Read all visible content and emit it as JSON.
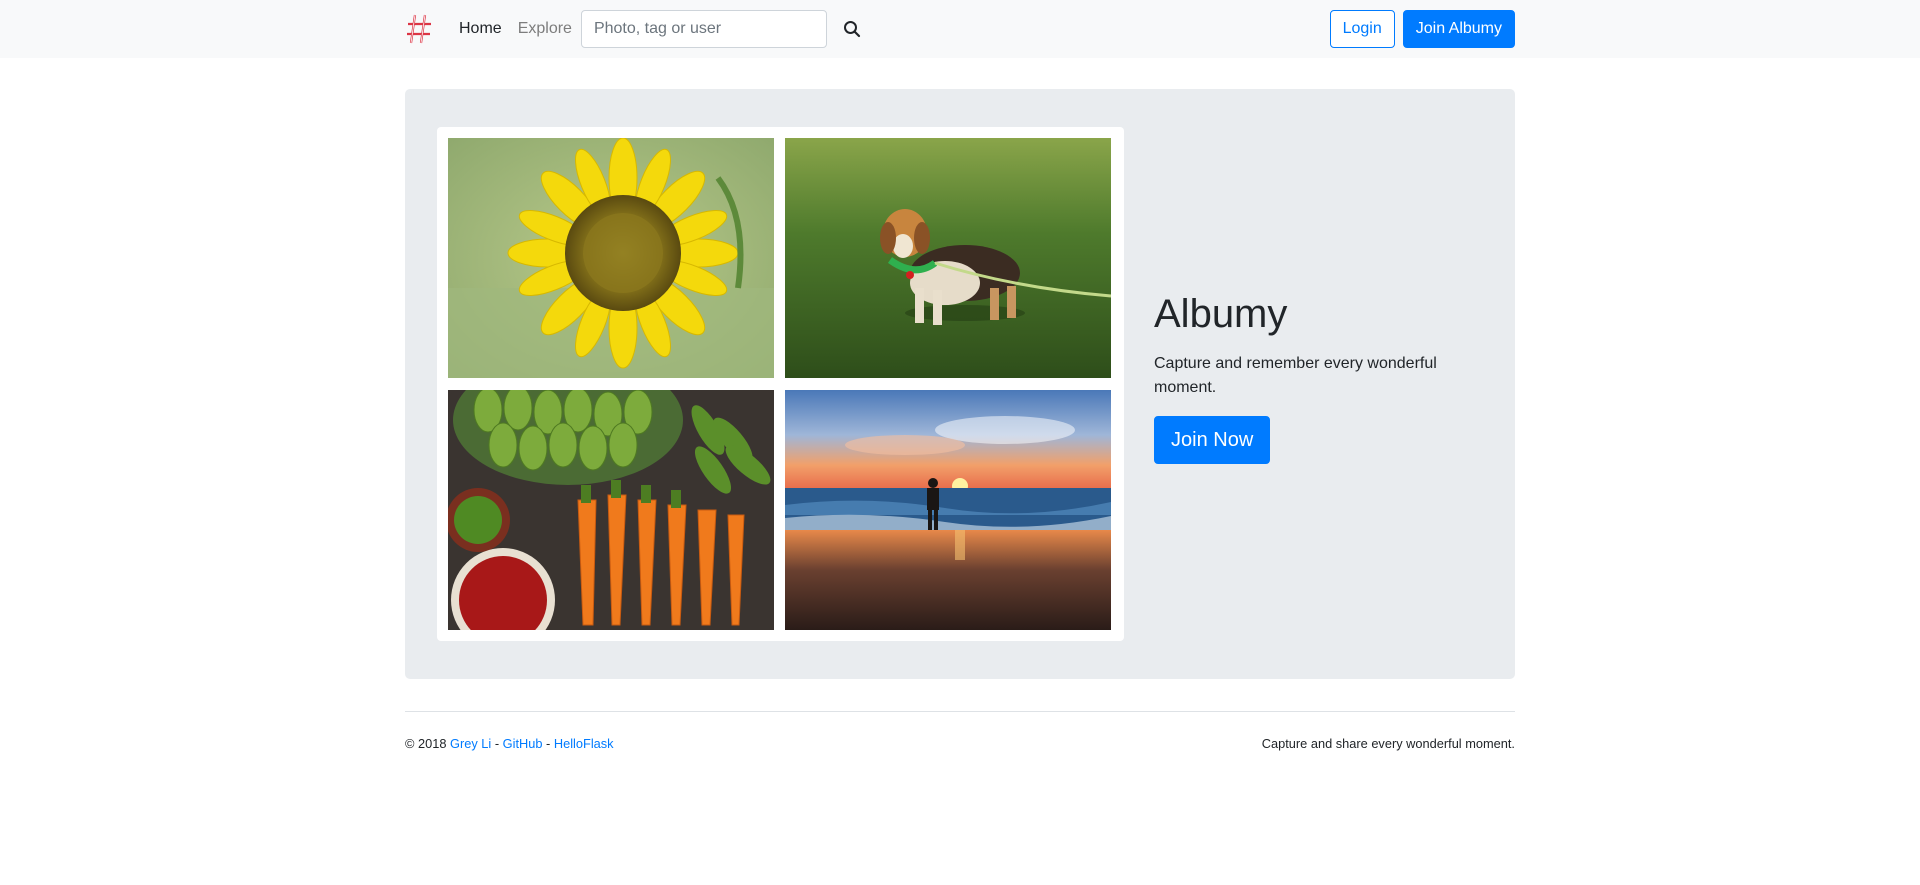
{
  "nav": {
    "logo_icon": "hashtag-logo-icon",
    "home_label": "Home",
    "explore_label": "Explore",
    "search_placeholder": "Photo, tag or user",
    "search_icon": "search-icon",
    "login_label": "Login",
    "join_label": "Join Albumy"
  },
  "hero": {
    "title": "Albumy",
    "subtitle": "Capture and remember every wonderful moment.",
    "cta_label": "Join Now",
    "photos": [
      "sunflower-photo",
      "beagle-dog-photo",
      "vegetables-photo",
      "sunset-beach-photo"
    ]
  },
  "footer": {
    "copyright": "© 2018",
    "author": "Grey Li",
    "sep1": " - ",
    "github": "GitHub",
    "sep2": " - ",
    "helloflask": "HelloFlask",
    "tagline": "Capture and share every wonderful moment."
  },
  "colors": {
    "accent": "#007bff",
    "navbar_bg": "#f8f9fa",
    "jumbotron_bg": "#e9ecef"
  }
}
